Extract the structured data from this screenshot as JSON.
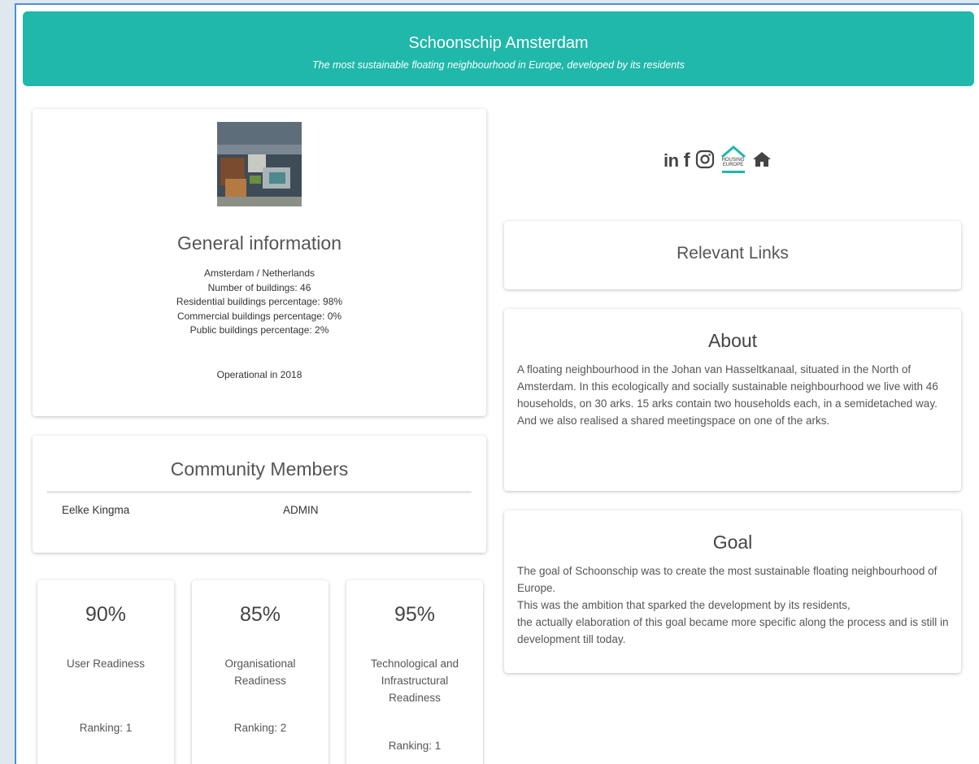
{
  "header": {
    "title": "Schoonschip Amsterdam",
    "subtitle": "The most sustainable floating neighbourhood in Europe, developed by its residents",
    "color": "#1fb8aa"
  },
  "general": {
    "heading": "General information",
    "location": "Amsterdam / Netherlands",
    "buildings": "Number of buildings: 46",
    "residential": "Residential buildings percentage: 98%",
    "commercial": "Commercial buildings percentage: 0%",
    "public": "Public buildings percentage: 2%",
    "operational": "Operational in 2018"
  },
  "community": {
    "heading": "Community Members",
    "members": [
      {
        "name": "Eelke Kingma",
        "role": "ADMIN"
      }
    ]
  },
  "readiness": [
    {
      "percent": "90%",
      "label": "User Readiness",
      "ranking": "Ranking: 1"
    },
    {
      "percent": "85%",
      "label": "Organisational Readiness",
      "ranking": "Ranking: 2"
    },
    {
      "percent": "95%",
      "label": "Technological and Infrastructural Readiness",
      "ranking": "Ranking: 1"
    }
  ],
  "social": {
    "icons": [
      "linkedin-icon",
      "facebook-icon",
      "instagram-icon",
      "housing-europe-logo",
      "home-icon"
    ],
    "linkedin": "in",
    "facebook": "f",
    "housing_europe_line1": "HOUSING",
    "housing_europe_line2": "EUROPE"
  },
  "links": {
    "heading": "Relevant Links"
  },
  "about": {
    "heading": "About",
    "text": "A floating neighbourhood in the Johan van Hasseltkanaal, situated in the North of Amsterdam. In this ecologically and socially sustainable neighbourhood we live with 46 households, on 30 arks. 15 arks contain two households each, in a semidetached way. And we also realised a shared meetingspace on one of the arks."
  },
  "goal": {
    "heading": "Goal",
    "line1": "The goal of Schoonschip was to create the most sustainable floating neighbourhood of Europe.",
    "line2": "This was the ambition that sparked the development by its residents,",
    "line3": "the actually elaboration of this goal became more specific along the process and is still in development till today."
  }
}
